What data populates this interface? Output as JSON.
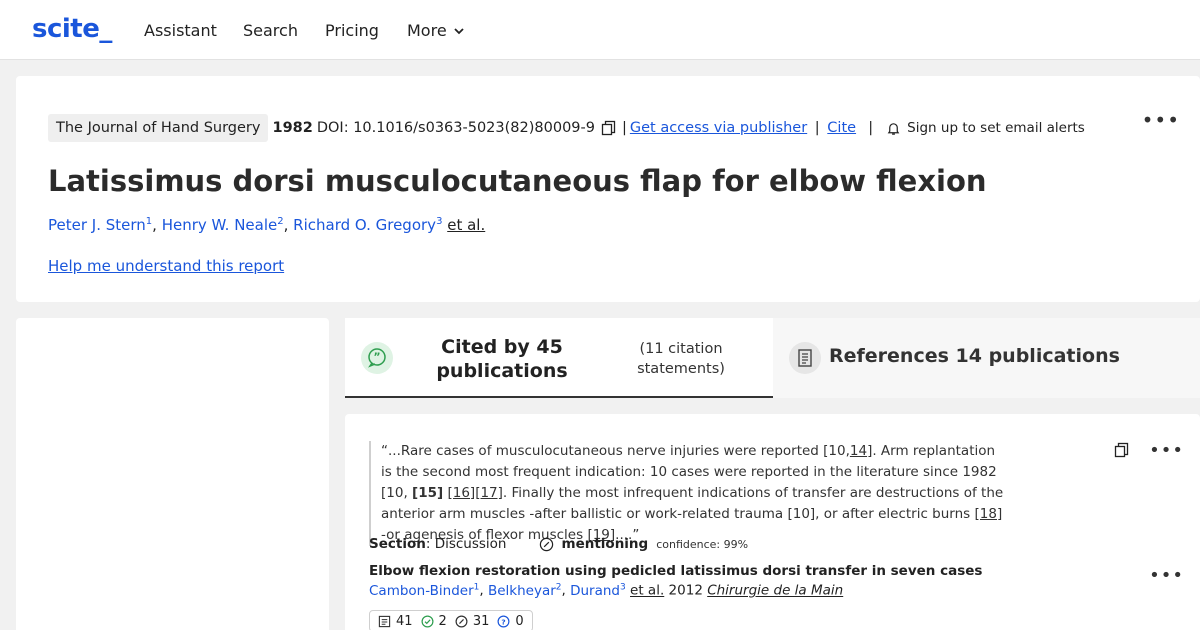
{
  "nav": {
    "logo": "scite_",
    "items": [
      "Assistant",
      "Search",
      "Pricing",
      "More"
    ]
  },
  "header": {
    "journal": "The Journal of Hand Surgery",
    "year": "1982",
    "doi": "DOI: 10.1016/s0363-5023(82)80009-9",
    "access_link": "Get access via publisher",
    "cite_link": "Cite",
    "alert_text": "Sign up to set email alerts",
    "title": "Latissimus dorsi musculocutaneous flap for elbow flexion",
    "authors": [
      {
        "name": "Peter J. Stern",
        "sup": "1"
      },
      {
        "name": "Henry W. Neale",
        "sup": "2"
      },
      {
        "name": "Richard O. Gregory",
        "sup": "3"
      }
    ],
    "etal": "et al.",
    "help_link": "Help me understand this report"
  },
  "tabs": {
    "cited_main": "Cited by 45 publications",
    "cited_sub": "(11 citation statements)",
    "refs_label": "References 14 publications"
  },
  "citation": {
    "quote_parts": [
      "“...Rare cases of musculocutaneous nerve injuries were reported [10,",
      "14",
      "]. Arm replantation is the second most frequent indication: 10 cases were reported in the literature since 1982 [10, ",
      "[15]",
      " ",
      "[16]",
      "[17]",
      ". Finally the most infrequent indications of transfer are destructions of the anterior arm muscles -after ballistic or work-related trauma [10], or after electric burns ",
      "[18]",
      " -or agenesis of flexor muscles ",
      "[19]",
      "....”"
    ],
    "section_label": "Section",
    "section_value": ": Discussion",
    "mention_label": "mentioning",
    "confidence": "confidence: 99%",
    "paper_title": "Elbow flexion restoration using pedicled latissimus dorsi transfer in seven cases",
    "paper_authors": [
      {
        "name": "Cambon-Binder",
        "sup": "1"
      },
      {
        "name": "Belkheyar",
        "sup": "2"
      },
      {
        "name": "Durand",
        "sup": "3"
      }
    ],
    "paper_etal": "et al.",
    "paper_year": "2012",
    "paper_journal": "Chirurgie de la Main",
    "stats": {
      "total": "41",
      "supporting": "2",
      "mentioning": "31",
      "contrasting": "0"
    }
  },
  "colors": {
    "link": "#1a56db",
    "supporting": "#2e9e4f",
    "contrasting": "#1a56db"
  }
}
